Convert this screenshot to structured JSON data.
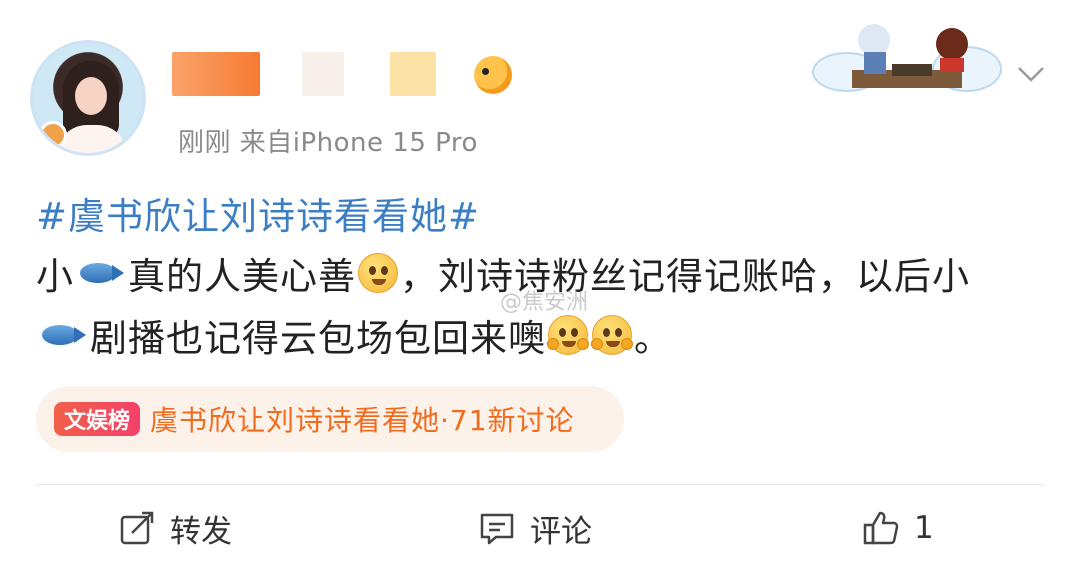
{
  "post": {
    "meta": "刚刚  来自iPhone 15 Pro",
    "hashtag": "#虞书欣让刘诗诗看看她#",
    "line1_a": "小",
    "line1_b": "真的人美心善",
    "line1_c": "，刘诗诗粉丝记得记账哈，以后小",
    "line2_a": "剧播也记得云包场包回来噢",
    "line2_end": "。",
    "watermark": "@焦安洲"
  },
  "topic": {
    "badge": "文娱榜",
    "text": "虞书欣让刘诗诗看看她·71新讨论"
  },
  "actions": {
    "repost": "转发",
    "comment": "评论",
    "like_count": "1"
  },
  "colors": {
    "link_blue": "#3b7ec4",
    "topic_orange": "#f26b1d",
    "badge_red": "#f2604a"
  }
}
